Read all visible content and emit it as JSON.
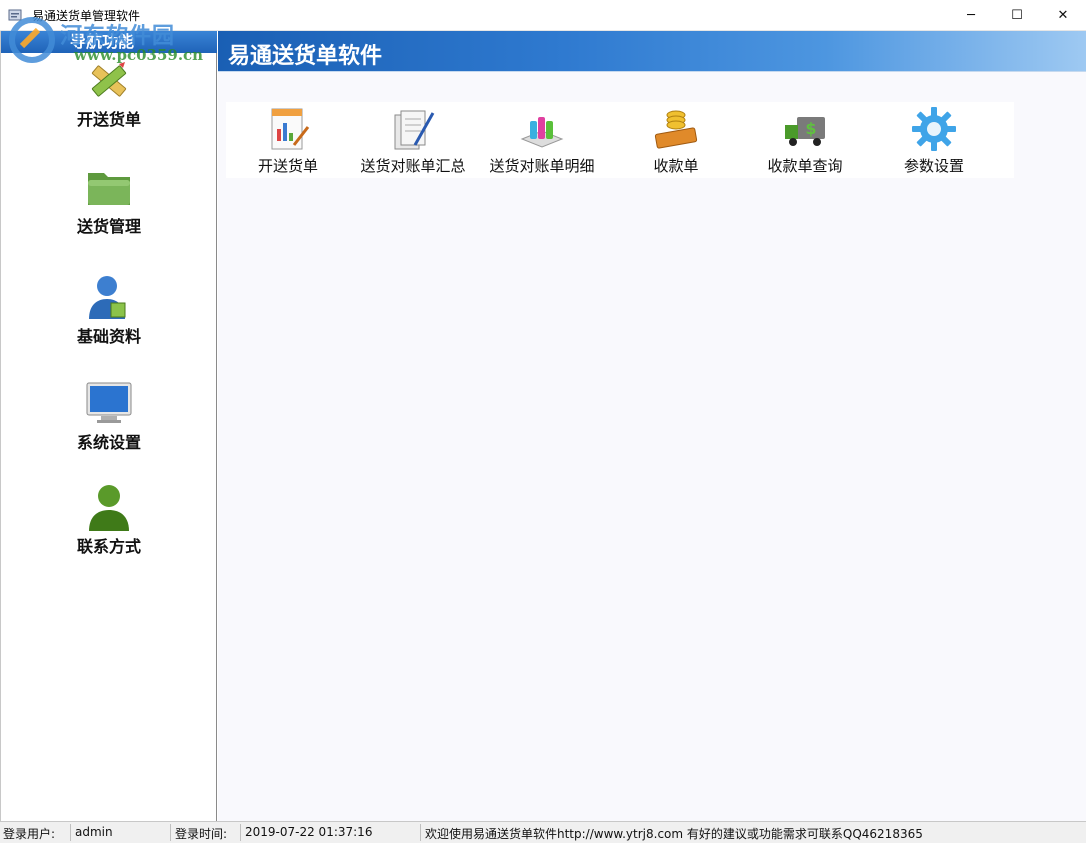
{
  "window": {
    "title": "易通送货单管理软件",
    "controls": {
      "minimize": "─",
      "maximize": "☐",
      "close": "✕"
    }
  },
  "watermark": {
    "text": "河东软件园",
    "url": "www.pc0359.cn"
  },
  "sidebar": {
    "header": "导航功能",
    "items": [
      {
        "label": "开送货单",
        "icon": "pencil-ruler-icon"
      },
      {
        "label": "送货管理",
        "icon": "folder-icon"
      },
      {
        "label": "基础资料",
        "icon": "user-icon"
      },
      {
        "label": "系统设置",
        "icon": "monitor-icon"
      },
      {
        "label": "联系方式",
        "icon": "contact-person-icon"
      }
    ]
  },
  "main": {
    "banner_title": "易通送货单软件",
    "toolbar": [
      {
        "label": "开送货单",
        "icon": "report-icon"
      },
      {
        "label": "送货对账单汇总",
        "icon": "documents-icon"
      },
      {
        "label": "送货对账单明细",
        "icon": "bottles-icon"
      },
      {
        "label": "收款单",
        "icon": "coins-icon"
      },
      {
        "label": "收款单查询",
        "icon": "money-truck-icon"
      },
      {
        "label": "参数设置",
        "icon": "gear-icon"
      }
    ]
  },
  "statusbar": {
    "user_label": "登录用户:",
    "user_value": "admin",
    "time_label": "登录时间:",
    "time_value": "2019-07-22  01:37:16",
    "message": "欢迎使用易通送货单软件http://www.ytrj8.com 有好的建议或功能需求可联系QQ46218365"
  },
  "colors": {
    "accent_blue": "#1f63b8",
    "sidebar_header": "#2a72c8",
    "folder_green": "#6aa84f",
    "status_bg": "#f0f0f0"
  }
}
